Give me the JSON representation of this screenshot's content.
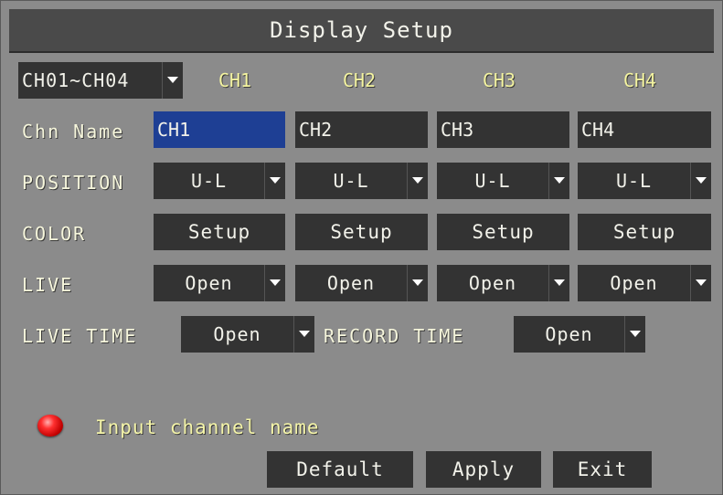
{
  "window": {
    "title": "Display Setup"
  },
  "group_select": {
    "value": "CH01~CH04"
  },
  "channel_headers": [
    "CH1",
    "CH2",
    "CH3",
    "CH4"
  ],
  "rows": {
    "chn_name": {
      "label": "Chn Name",
      "values": [
        "CH1",
        "CH2",
        "CH3",
        "CH4"
      ]
    },
    "position": {
      "label": "POSITION",
      "values": [
        "U-L",
        "U-L",
        "U-L",
        "U-L"
      ]
    },
    "color": {
      "label": "COLOR",
      "buttons": [
        "Setup",
        "Setup",
        "Setup",
        "Setup"
      ]
    },
    "live": {
      "label": "LIVE",
      "values": [
        "Open",
        "Open",
        "Open",
        "Open"
      ]
    }
  },
  "live_time": {
    "label": "LIVE TIME",
    "value": "Open"
  },
  "record_time": {
    "label": "RECORD TIME",
    "value": "Open"
  },
  "hint": {
    "text": "Input channel name",
    "icon": "red-indicator-led"
  },
  "buttons": {
    "default": "Default",
    "apply": "Apply",
    "exit": "Exit"
  },
  "colors": {
    "selected_field": "#1e3f94",
    "field_bg": "#333333",
    "background": "#8b8b8b"
  }
}
